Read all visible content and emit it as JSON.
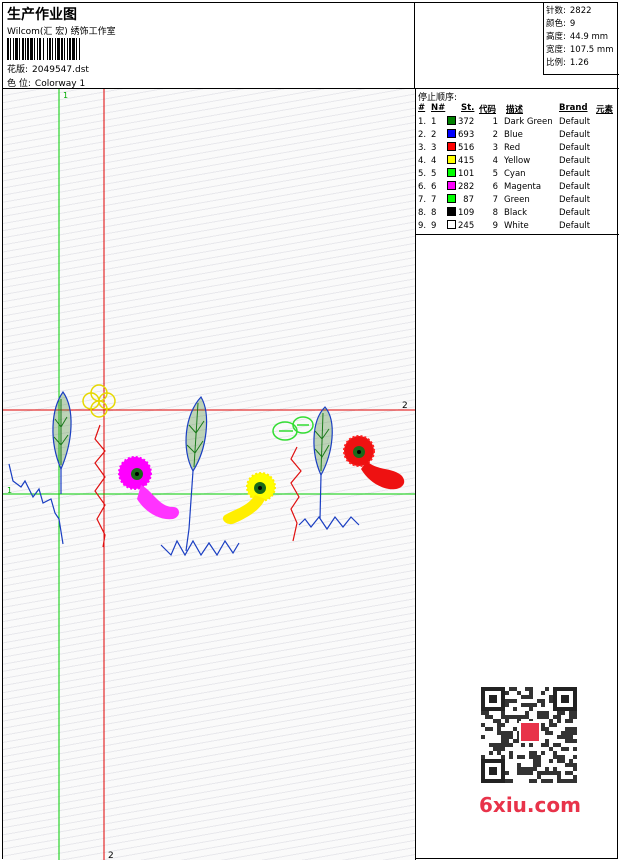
{
  "header": {
    "title": "生产作业图",
    "subtitle": "Wilcom(汇 宏) 绣饰工作室",
    "design_label": "花版:",
    "design_value": "2049547.dst",
    "colorway_label": "色 位:",
    "colorway_value": "Colorway 1"
  },
  "stats": [
    {
      "label": "针数:",
      "value": "2822"
    },
    {
      "label": "颜色:",
      "value": "9"
    },
    {
      "label": "高度:",
      "value": "44.9 mm"
    },
    {
      "label": "宽度:",
      "value": "107.5 mm"
    },
    {
      "label": "比例:",
      "value": "1.26"
    }
  ],
  "table": {
    "title": "停止顺序:",
    "headers": {
      "idx": "#",
      "n": "N#",
      "st": "St.",
      "code": "代码",
      "desc": "描述",
      "brand": "Brand",
      "elem": "元素"
    },
    "rows": [
      {
        "idx": "1.",
        "n": "1",
        "st": "372",
        "code": "1",
        "desc": "Dark Green",
        "brand": "Default",
        "color": "#008000"
      },
      {
        "idx": "2.",
        "n": "2",
        "st": "693",
        "code": "2",
        "desc": "Blue",
        "brand": "Default",
        "color": "#0000ff"
      },
      {
        "idx": "3.",
        "n": "3",
        "st": "516",
        "code": "3",
        "desc": "Red",
        "brand": "Default",
        "color": "#ff0000"
      },
      {
        "idx": "4.",
        "n": "4",
        "st": "415",
        "code": "4",
        "desc": "Yellow",
        "brand": "Default",
        "color": "#ffff00"
      },
      {
        "idx": "5.",
        "n": "5",
        "st": "101",
        "code": "5",
        "desc": "Cyan",
        "brand": "Default",
        "color": "#00ff00"
      },
      {
        "idx": "6.",
        "n": "6",
        "st": "282",
        "code": "6",
        "desc": "Magenta",
        "brand": "Default",
        "color": "#ff00ff"
      },
      {
        "idx": "7.",
        "n": "7",
        "st": "87",
        "code": "7",
        "desc": "Green",
        "brand": "Default",
        "color": "#00ff00"
      },
      {
        "idx": "8.",
        "n": "8",
        "st": "109",
        "code": "8",
        "desc": "Black",
        "brand": "Default",
        "color": "#000000"
      },
      {
        "idx": "9.",
        "n": "9",
        "st": "245",
        "code": "9",
        "desc": "White",
        "brand": "Default",
        "color": "#ffffff"
      }
    ]
  },
  "canvas": {
    "guide_labels": {
      "v1": "1",
      "v2": "2",
      "h1": "1",
      "h2": "2"
    }
  },
  "watermark": {
    "text": "6xiu.com"
  }
}
